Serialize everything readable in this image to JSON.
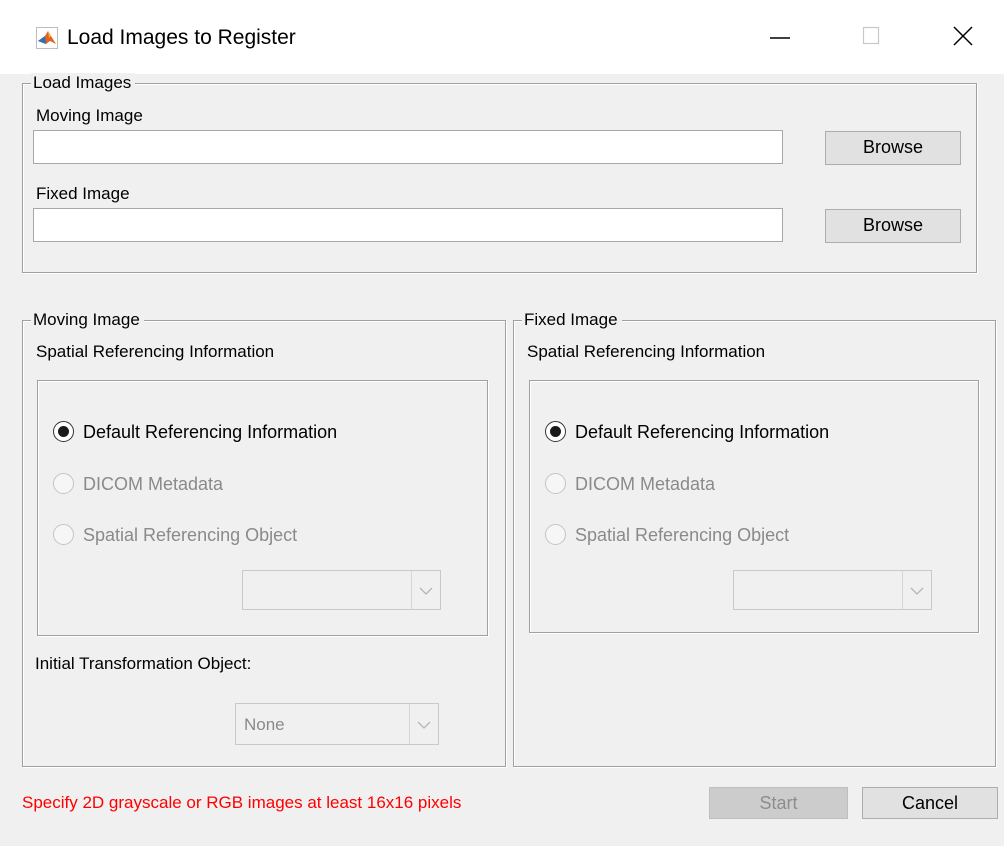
{
  "window": {
    "title": "Load Images to Register",
    "icon": "matlab-logo-icon",
    "controls": [
      "minimize-icon",
      "maximize-icon",
      "close-icon"
    ]
  },
  "load_images": {
    "group_title": "Load Images",
    "moving": {
      "label": "Moving Image",
      "value": "",
      "browse_label": "Browse"
    },
    "fixed": {
      "label": "Fixed Image",
      "value": "",
      "browse_label": "Browse"
    }
  },
  "moving_panel": {
    "group_title": "Moving Image",
    "subtitle": "Spatial Referencing Information",
    "options": [
      {
        "label": "Default Referencing Information",
        "checked": true,
        "enabled": true
      },
      {
        "label": "DICOM Metadata",
        "checked": false,
        "enabled": false
      },
      {
        "label": "Spatial Referencing Object",
        "checked": false,
        "enabled": false
      }
    ],
    "object_select_value": "",
    "transform_label": "Initial Transformation Object:",
    "transform_select_value": "None"
  },
  "fixed_panel": {
    "group_title": "Fixed Image",
    "subtitle": "Spatial Referencing Information",
    "options": [
      {
        "label": "Default Referencing Information",
        "checked": true,
        "enabled": true
      },
      {
        "label": "DICOM Metadata",
        "checked": false,
        "enabled": false
      },
      {
        "label": "Spatial Referencing Object",
        "checked": false,
        "enabled": false
      }
    ],
    "object_select_value": ""
  },
  "footer": {
    "message": "Specify 2D grayscale or RGB images at least 16x16 pixels",
    "message_color": "#ff0000",
    "start_label": "Start",
    "start_enabled": false,
    "cancel_label": "Cancel"
  }
}
